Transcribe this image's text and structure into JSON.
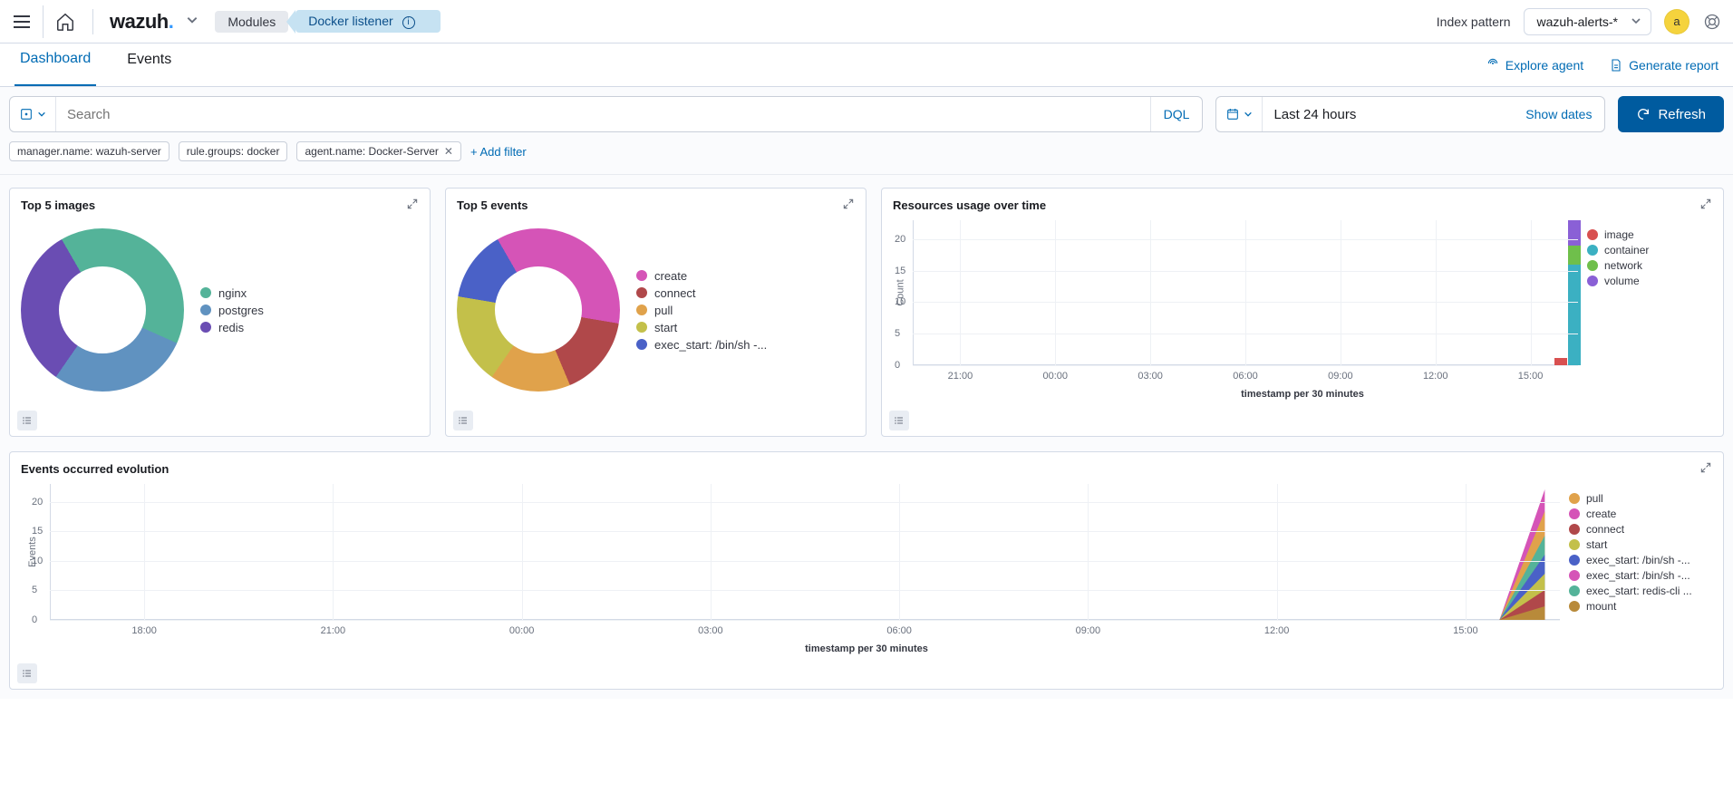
{
  "topbar": {
    "breadcrumb": {
      "modules": "Modules",
      "docker": "Docker listener"
    },
    "index_pattern_label": "Index pattern",
    "index_pattern_value": "wazuh-alerts-*",
    "avatar": "a"
  },
  "tabs": {
    "dashboard": "Dashboard",
    "events": "Events",
    "explore_agent": "Explore agent",
    "generate_report": "Generate report"
  },
  "query": {
    "search_placeholder": "Search",
    "dql": "DQL",
    "date_range": "Last 24 hours",
    "show_dates": "Show dates",
    "refresh": "Refresh"
  },
  "filters": {
    "f1": "manager.name: wazuh-server",
    "f2": "rule.groups: docker",
    "f3": "agent.name: Docker-Server",
    "add": "+ Add filter"
  },
  "panels": {
    "top5_images": "Top 5 images",
    "top5_events": "Top 5 events",
    "resources": "Resources usage over time",
    "events_evo": "Events occurred evolution"
  },
  "chart_data": [
    {
      "type": "pie",
      "title": "Top 5 images",
      "series": [
        {
          "name": "nginx",
          "value": 40,
          "color": "#54b399"
        },
        {
          "name": "postgres",
          "value": 28,
          "color": "#6092c0"
        },
        {
          "name": "redis",
          "value": 32,
          "color": "#6a4db3"
        }
      ]
    },
    {
      "type": "pie",
      "title": "Top 5 events",
      "series": [
        {
          "name": "create",
          "value": 36,
          "color": "#d554b7"
        },
        {
          "name": "connect",
          "value": 16,
          "color": "#b0484a"
        },
        {
          "name": "pull",
          "value": 16,
          "color": "#e0a24b"
        },
        {
          "name": "start",
          "value": 18,
          "color": "#c3c04a"
        },
        {
          "name": "exec_start: /bin/sh -...",
          "value": 14,
          "color": "#4a61c7"
        }
      ]
    },
    {
      "type": "bar",
      "title": "Resources usage over time",
      "xlabel": "timestamp per 30 minutes",
      "ylabel": "Count",
      "ylim": [
        0,
        23
      ],
      "yticks": [
        0,
        5,
        10,
        15,
        20
      ],
      "xticks": [
        "21:00",
        "00:00",
        "03:00",
        "06:00",
        "09:00",
        "12:00",
        "15:00"
      ],
      "legend": [
        {
          "name": "image",
          "color": "#d85050"
        },
        {
          "name": "container",
          "color": "#3bb0c2"
        },
        {
          "name": "network",
          "color": "#6fbf4b"
        },
        {
          "name": "volume",
          "color": "#8a60d6"
        }
      ],
      "bars": [
        {
          "x_frac": 0.965,
          "segments": [
            {
              "name": "image",
              "value": 1.2,
              "color": "#d85050"
            }
          ]
        },
        {
          "x_frac": 0.985,
          "segments": [
            {
              "name": "container",
              "value": 16,
              "color": "#3bb0c2"
            },
            {
              "name": "network",
              "value": 3,
              "color": "#6fbf4b"
            },
            {
              "name": "volume",
              "value": 4,
              "color": "#8a60d6"
            }
          ]
        }
      ]
    },
    {
      "type": "area",
      "title": "Events occurred evolution",
      "xlabel": "timestamp per 30 minutes",
      "ylabel": "Events",
      "ylim": [
        0,
        23
      ],
      "yticks": [
        0,
        5,
        10,
        15,
        20
      ],
      "xticks": [
        "18:00",
        "21:00",
        "00:00",
        "03:00",
        "06:00",
        "09:00",
        "12:00",
        "15:00"
      ],
      "legend": [
        {
          "name": "pull",
          "color": "#e0a24b"
        },
        {
          "name": "create",
          "color": "#d554b7"
        },
        {
          "name": "connect",
          "color": "#b0484a"
        },
        {
          "name": "start",
          "color": "#c3c04a"
        },
        {
          "name": "exec_start: /bin/sh -...",
          "color": "#4a61c7"
        },
        {
          "name": "exec_start: /bin/sh -...",
          "color": "#d554b7"
        },
        {
          "name": "exec_start: redis-cli ...",
          "color": "#54b399"
        },
        {
          "name": "mount",
          "color": "#b88a3a"
        }
      ]
    }
  ]
}
